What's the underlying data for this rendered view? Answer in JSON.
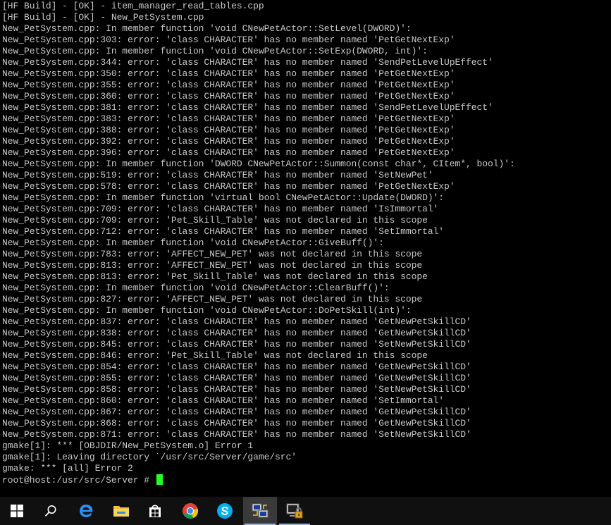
{
  "terminal": {
    "lines": [
      "[HF Build] - [OK] - item_manager_read_tables.cpp",
      "[HF Build] - [OK] - New_PetSystem.cpp",
      "New_PetSystem.cpp: In member function 'void CNewPetActor::SetLevel(DWORD)':",
      "New_PetSystem.cpp:303: error: 'class CHARACTER' has no member named 'PetGetNextExp'",
      "New_PetSystem.cpp: In member function 'void CNewPetActor::SetExp(DWORD, int)':",
      "New_PetSystem.cpp:344: error: 'class CHARACTER' has no member named 'SendPetLevelUpEffect'",
      "New_PetSystem.cpp:350: error: 'class CHARACTER' has no member named 'PetGetNextExp'",
      "New_PetSystem.cpp:355: error: 'class CHARACTER' has no member named 'PetGetNextExp'",
      "New_PetSystem.cpp:360: error: 'class CHARACTER' has no member named 'PetGetNextExp'",
      "New_PetSystem.cpp:381: error: 'class CHARACTER' has no member named 'SendPetLevelUpEffect'",
      "New_PetSystem.cpp:383: error: 'class CHARACTER' has no member named 'PetGetNextExp'",
      "New_PetSystem.cpp:388: error: 'class CHARACTER' has no member named 'PetGetNextExp'",
      "New_PetSystem.cpp:392: error: 'class CHARACTER' has no member named 'PetGetNextExp'",
      "New_PetSystem.cpp:396: error: 'class CHARACTER' has no member named 'PetGetNextExp'",
      "New_PetSystem.cpp: In member function 'DWORD CNewPetActor::Summon(const char*, CItem*, bool)':",
      "New_PetSystem.cpp:519: error: 'class CHARACTER' has no member named 'SetNewPet'",
      "New_PetSystem.cpp:578: error: 'class CHARACTER' has no member named 'PetGetNextExp'",
      "New_PetSystem.cpp: In member function 'virtual bool CNewPetActor::Update(DWORD)':",
      "New_PetSystem.cpp:709: error: 'class CHARACTER' has no member named 'IsImmortal'",
      "New_PetSystem.cpp:709: error: 'Pet_Skill_Table' was not declared in this scope",
      "New_PetSystem.cpp:712: error: 'class CHARACTER' has no member named 'SetImmortal'",
      "New_PetSystem.cpp: In member function 'void CNewPetActor::GiveBuff()':",
      "New_PetSystem.cpp:783: error: 'AFFECT_NEW_PET' was not declared in this scope",
      "New_PetSystem.cpp:813: error: 'AFFECT_NEW_PET' was not declared in this scope",
      "New_PetSystem.cpp:813: error: 'Pet_Skill_Table' was not declared in this scope",
      "New_PetSystem.cpp: In member function 'void CNewPetActor::ClearBuff()':",
      "New_PetSystem.cpp:827: error: 'AFFECT_NEW_PET' was not declared in this scope",
      "New_PetSystem.cpp: In member function 'void CNewPetActor::DoPetSkill(int)':",
      "New_PetSystem.cpp:837: error: 'class CHARACTER' has no member named 'GetNewPetSkillCD'",
      "New_PetSystem.cpp:838: error: 'class CHARACTER' has no member named 'GetNewPetSkillCD'",
      "New_PetSystem.cpp:845: error: 'class CHARACTER' has no member named 'SetNewPetSkillCD'",
      "New_PetSystem.cpp:846: error: 'Pet_Skill_Table' was not declared in this scope",
      "New_PetSystem.cpp:854: error: 'class CHARACTER' has no member named 'GetNewPetSkillCD'",
      "New_PetSystem.cpp:855: error: 'class CHARACTER' has no member named 'GetNewPetSkillCD'",
      "New_PetSystem.cpp:858: error: 'class CHARACTER' has no member named 'SetNewPetSkillCD'",
      "New_PetSystem.cpp:860: error: 'class CHARACTER' has no member named 'SetImmortal'",
      "New_PetSystem.cpp:867: error: 'class CHARACTER' has no member named 'GetNewPetSkillCD'",
      "New_PetSystem.cpp:868: error: 'class CHARACTER' has no member named 'GetNewPetSkillCD'",
      "New_PetSystem.cpp:871: error: 'class CHARACTER' has no member named 'SetNewPetSkillCD'",
      "gmake[1]: *** [OBJDIR/New_PetSystem.o] Error 1",
      "gmake[1]: Leaving directory `/usr/src/Server/game/src'",
      "gmake: *** [all] Error 2"
    ],
    "prompt": "root@host:/usr/src/Server # ",
    "cursor_color": "#22ff22"
  },
  "taskbar": {
    "background": "#101010",
    "items": [
      {
        "icon": "windows-start-icon"
      },
      {
        "icon": "search-icon"
      },
      {
        "icon": "edge-browser-icon"
      },
      {
        "icon": "file-explorer-icon"
      },
      {
        "icon": "store-icon"
      },
      {
        "icon": "chrome-icon"
      },
      {
        "icon": "skype-icon"
      },
      {
        "icon": "network-terminal-icon"
      },
      {
        "icon": "secure-terminal-icon"
      }
    ]
  }
}
